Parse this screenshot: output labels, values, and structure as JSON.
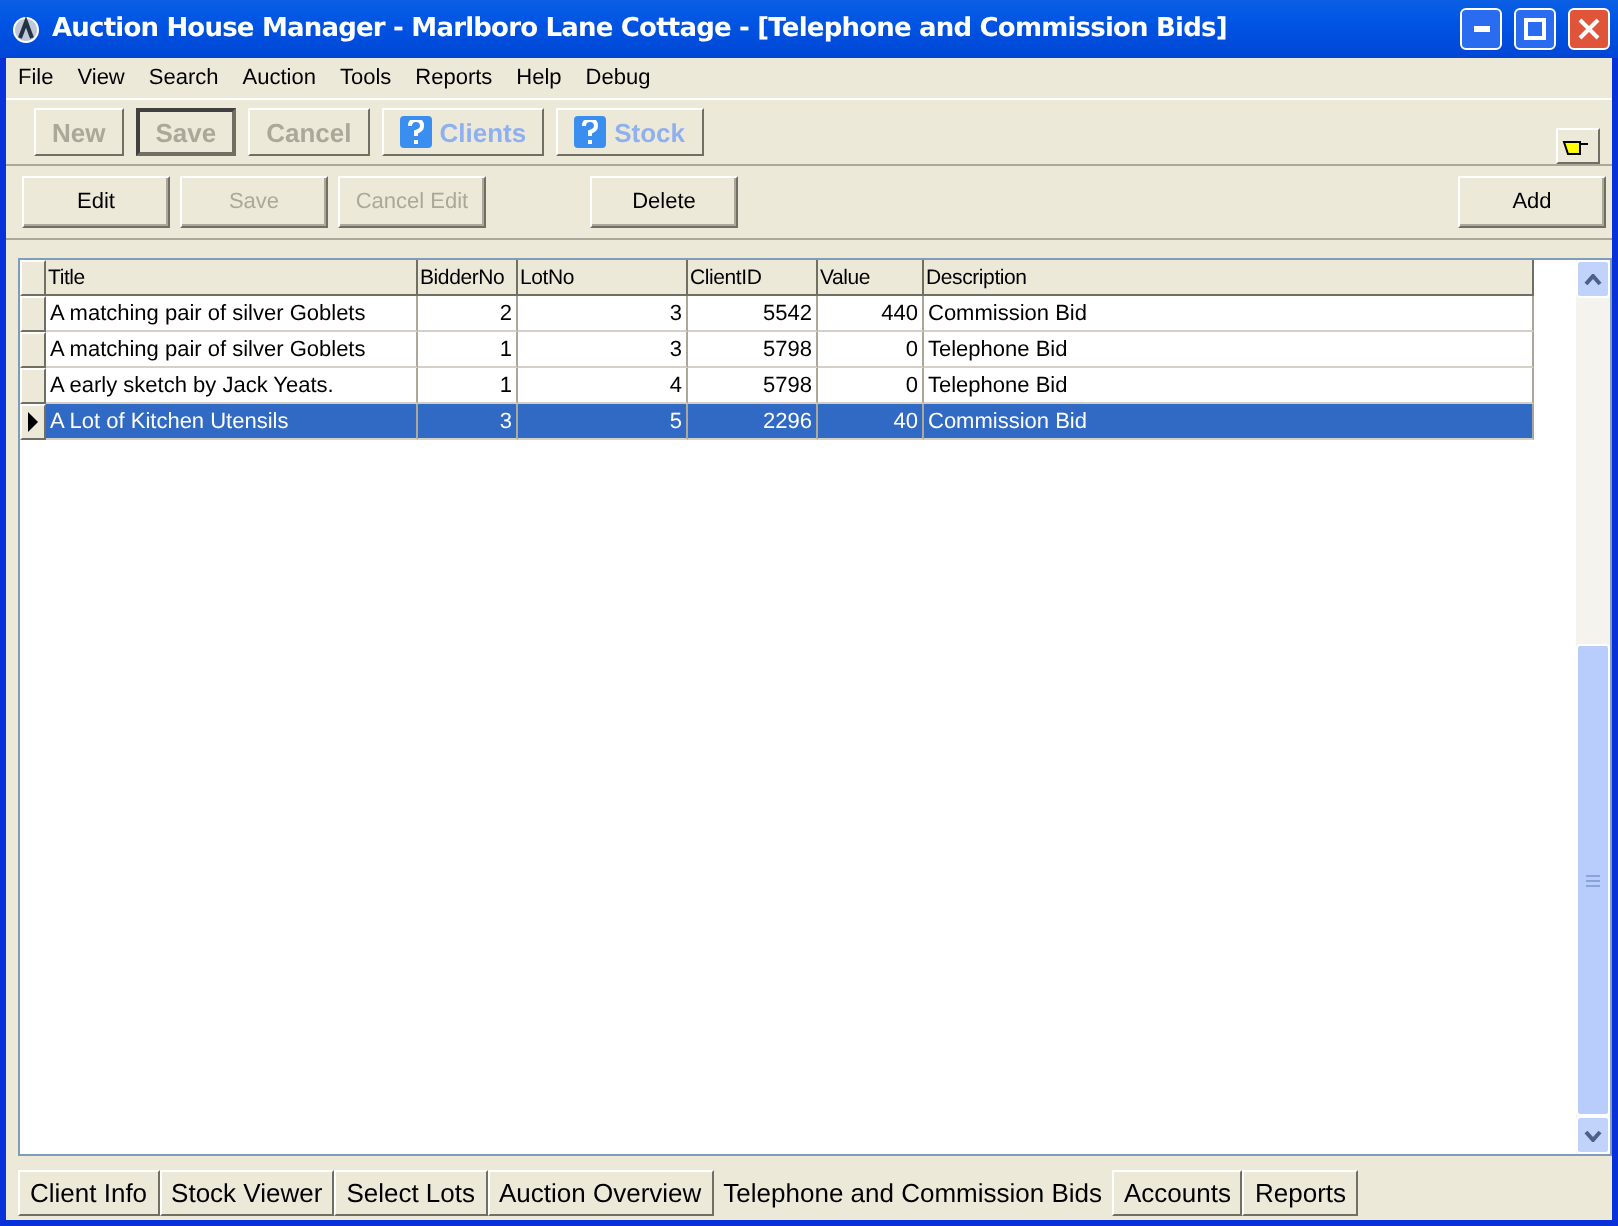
{
  "window": {
    "title": "Auction House Manager - Marlboro Lane Cottage - [Telephone and Commission Bids]"
  },
  "menu": [
    "File",
    "View",
    "Search",
    "Auction",
    "Tools",
    "Reports",
    "Help",
    "Debug"
  ],
  "toolbar": [
    {
      "label": "New",
      "disabled": true,
      "default": false,
      "help_icon": false
    },
    {
      "label": "Save",
      "disabled": true,
      "default": true,
      "help_icon": false
    },
    {
      "label": "Cancel",
      "disabled": true,
      "default": false,
      "help_icon": false
    },
    {
      "label": "Clients",
      "disabled": true,
      "default": false,
      "help_icon": true
    },
    {
      "label": "Stock",
      "disabled": true,
      "default": false,
      "help_icon": true
    }
  ],
  "actions": [
    {
      "label": "Edit",
      "disabled": false
    },
    {
      "label": "Save",
      "disabled": true
    },
    {
      "label": "Cancel Edit",
      "disabled": true
    },
    {
      "label": "Delete",
      "disabled": false
    },
    {
      "label": "Add",
      "disabled": false
    }
  ],
  "table": {
    "columns": [
      "Title",
      "BidderNo",
      "LotNo",
      "ClientID",
      "Value",
      "Description"
    ],
    "rows": [
      {
        "cells": [
          "A matching pair of silver Goblets",
          "2",
          "3",
          "5542",
          "440",
          "Commission Bid"
        ],
        "selected": false
      },
      {
        "cells": [
          "A matching pair of silver Goblets",
          "1",
          "3",
          "5798",
          "0",
          "Telephone Bid"
        ],
        "selected": false
      },
      {
        "cells": [
          "A early sketch by Jack Yeats.",
          "1",
          "4",
          "5798",
          "0",
          "Telephone Bid"
        ],
        "selected": false
      },
      {
        "cells": [
          "A Lot of Kitchen Utensils",
          "3",
          "5",
          "2296",
          "40",
          "Commission Bid"
        ],
        "selected": true
      }
    ]
  },
  "tabs": [
    {
      "label": "Client Info",
      "selected": false
    },
    {
      "label": "Stock Viewer",
      "selected": false
    },
    {
      "label": "Select Lots",
      "selected": false
    },
    {
      "label": "Auction Overview",
      "selected": false
    },
    {
      "label": "Telephone and Commission Bids",
      "selected": true
    },
    {
      "label": "Accounts",
      "selected": false
    },
    {
      "label": "Reports",
      "selected": false
    }
  ]
}
